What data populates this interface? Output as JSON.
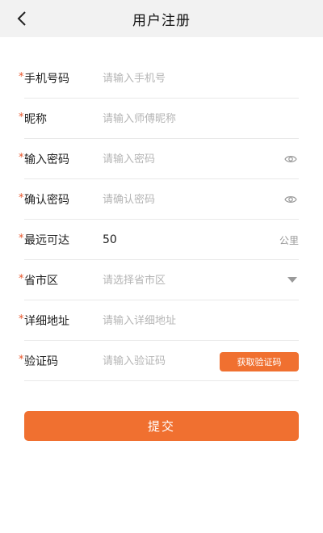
{
  "header": {
    "title": "用户注册",
    "back_icon": "chevron-left-icon"
  },
  "form": {
    "required_mark": "*",
    "phone": {
      "label": "手机号码",
      "placeholder": "请输入手机号"
    },
    "nickname": {
      "label": "昵称",
      "placeholder": "请输入师傅昵称"
    },
    "password": {
      "label": "输入密码",
      "placeholder": "请输入密码",
      "icon": "eye-icon"
    },
    "confirm_password": {
      "label": "确认密码",
      "placeholder": "请确认密码",
      "icon": "eye-icon"
    },
    "max_distance": {
      "label": "最远可达",
      "value": "50",
      "unit": "公里"
    },
    "region": {
      "label": "省市区",
      "placeholder": "请选择省市区",
      "icon": "caret-down-icon"
    },
    "address": {
      "label": "详细地址",
      "placeholder": "请输入详细地址"
    },
    "verify_code": {
      "label": "验证码",
      "placeholder": "请输入验证码",
      "button_label": "获取验证码"
    }
  },
  "submit": {
    "label": "提交"
  },
  "colors": {
    "accent": "#f07030",
    "required": "#e8552a",
    "header_bg": "#f2f2f2"
  }
}
